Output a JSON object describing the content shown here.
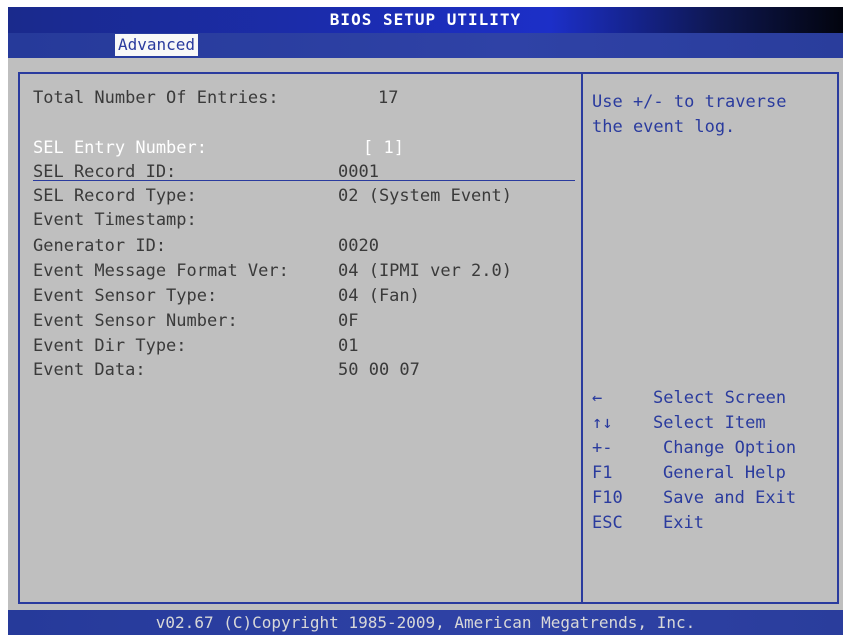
{
  "title": "BIOS SETUP UTILITY",
  "menu": {
    "active_tab": "Advanced"
  },
  "entries_total": {
    "label": "Total Number Of Entries:",
    "value": "17"
  },
  "fields": [
    {
      "label": "SEL Entry Number:",
      "value": "[ 1]"
    },
    {
      "label": "SEL Record ID:",
      "value": "0001"
    },
    {
      "label": "SEL Record Type:",
      "value": "02 (System Event)"
    },
    {
      "label": "Event Timestamp:",
      "value": ""
    },
    {
      "label": "Generator ID:",
      "value": "0020"
    },
    {
      "label": "Event Message Format Ver:",
      "value": "04 (IPMI ver 2.0)"
    },
    {
      "label": "Event Sensor Type:",
      "value": "04 (Fan)"
    },
    {
      "label": "Event Sensor Number:",
      "value": "0F"
    },
    {
      "label": "Event Dir Type:",
      "value": "01"
    },
    {
      "label": "Event Data:",
      "value": "50 00 07"
    }
  ],
  "help": {
    "text": "Use +/- to traverse the event log."
  },
  "keys": [
    {
      "key": "←",
      "desc": "Select Screen",
      "icon": "arrow-left-icon"
    },
    {
      "key": "↑↓",
      "desc": "Select Item",
      "icon": "arrow-up-down-icon"
    },
    {
      "key": "+-",
      "desc": "Change Option",
      "icon": "plus-minus-icon"
    },
    {
      "key": "F1",
      "desc": "General Help",
      "icon": ""
    },
    {
      "key": "F10",
      "desc": "Save and Exit",
      "icon": ""
    },
    {
      "key": "ESC",
      "desc": "Exit",
      "icon": ""
    }
  ],
  "footer": "v02.67 (C)Copyright 1985-2009, American Megatrends, Inc.",
  "colors": {
    "background": "#bfbfbf",
    "accent": "#2a3b9e",
    "selected_text": "#ffffff"
  }
}
